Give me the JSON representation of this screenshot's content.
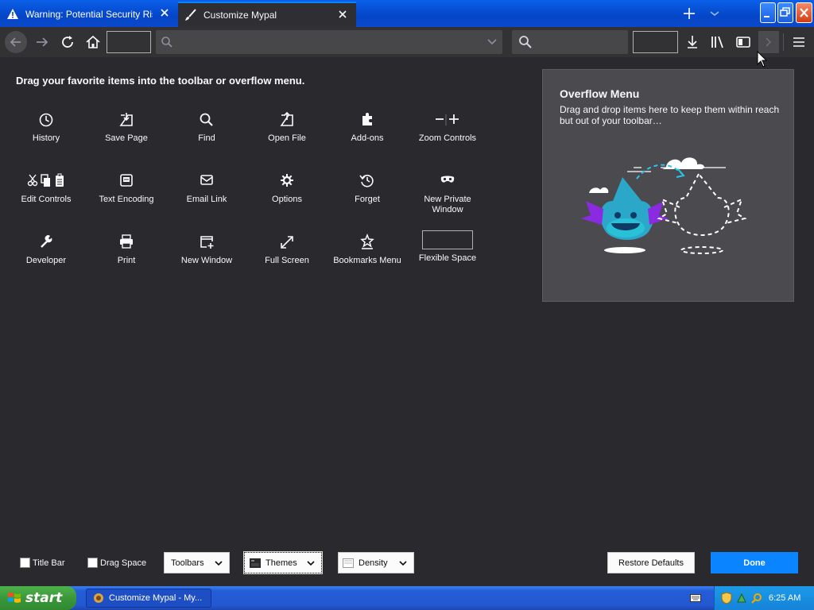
{
  "tabs": [
    {
      "title": "Warning: Potential Security Risk Ahead",
      "icon": "warning-icon"
    },
    {
      "title": "Customize Mypal",
      "icon": "paintbrush-icon"
    }
  ],
  "palette": {
    "heading": "Drag your favorite items into the toolbar or overflow menu.",
    "items": [
      {
        "label": "History",
        "icon": "history-icon"
      },
      {
        "label": "Save Page",
        "icon": "save-page-icon"
      },
      {
        "label": "Find",
        "icon": "find-icon"
      },
      {
        "label": "Open File",
        "icon": "open-file-icon"
      },
      {
        "label": "Add-ons",
        "icon": "addons-icon"
      },
      {
        "label": "Zoom Controls",
        "icon": "zoom-icon"
      },
      {
        "label": "Edit Controls",
        "icon": "edit-controls-icon"
      },
      {
        "label": "Text Encoding",
        "icon": "text-encoding-icon"
      },
      {
        "label": "Email Link",
        "icon": "email-icon"
      },
      {
        "label": "Options",
        "icon": "gear-icon"
      },
      {
        "label": "Forget",
        "icon": "forget-icon"
      },
      {
        "label": "New Private Window",
        "icon": "private-mask-icon"
      },
      {
        "label": "Developer",
        "icon": "wrench-icon"
      },
      {
        "label": "Print",
        "icon": "print-icon"
      },
      {
        "label": "New Window",
        "icon": "new-window-icon"
      },
      {
        "label": "Full Screen",
        "icon": "fullscreen-icon"
      },
      {
        "label": "Bookmarks Menu",
        "icon": "bookmarks-menu-icon"
      },
      {
        "label": "Flexible Space",
        "icon": "flexible-space-icon"
      }
    ]
  },
  "overflow": {
    "title": "Overflow Menu",
    "description": "Drag and drop items here to keep them within reach but out of your toolbar…"
  },
  "footer": {
    "title_bar": "Title Bar",
    "drag_space": "Drag Space",
    "toolbars": "Toolbars",
    "themes": "Themes",
    "density": "Density",
    "restore": "Restore Defaults",
    "done": "Done"
  },
  "taskbar": {
    "start": "start",
    "task": "Customize Mypal - My...",
    "clock": "6:25 AM"
  },
  "colors": {
    "accent": "#0a84ff",
    "background": "#2a2a2e",
    "panel": "#4a4a4f",
    "taskbar": "#245dd7",
    "start": "#3b973a"
  }
}
